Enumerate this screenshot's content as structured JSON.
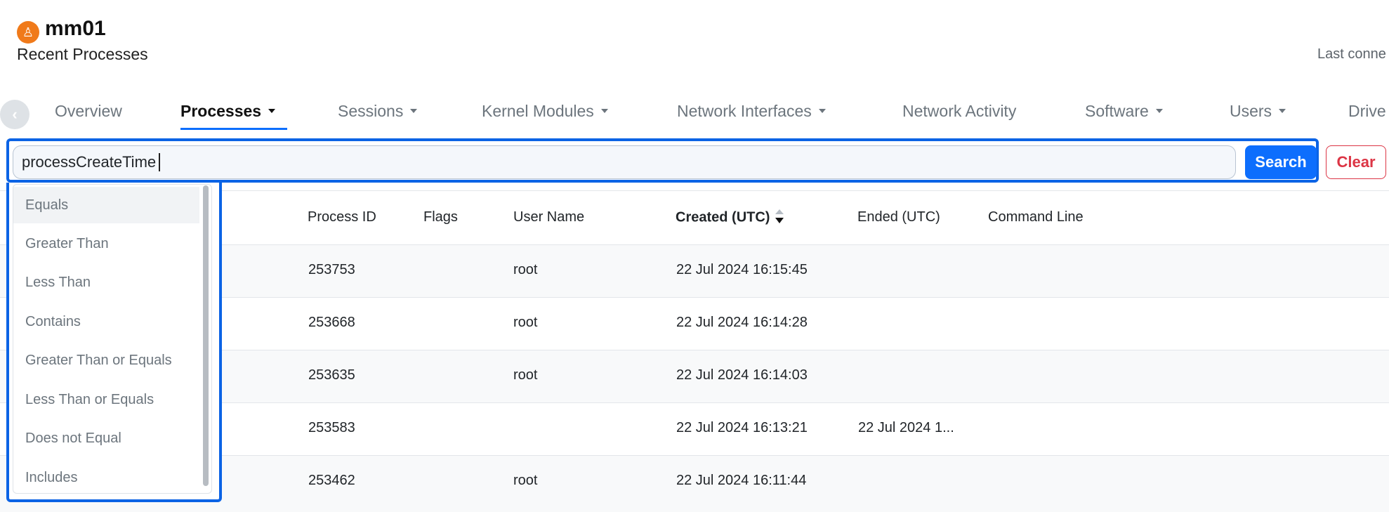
{
  "header": {
    "host_icon": "penguin-icon",
    "host_glyph": "♙",
    "host_name": "mm01",
    "subtitle": "Recent Processes",
    "last_connected": "Last conne"
  },
  "tabs": [
    {
      "label": "Overview",
      "dropdown": false,
      "active": false
    },
    {
      "label": "Processes",
      "dropdown": true,
      "active": true
    },
    {
      "label": "Sessions",
      "dropdown": true,
      "active": false
    },
    {
      "label": "Kernel Modules",
      "dropdown": true,
      "active": false
    },
    {
      "label": "Network Interfaces",
      "dropdown": true,
      "active": false
    },
    {
      "label": "Network Activity",
      "dropdown": false,
      "active": false
    },
    {
      "label": "Software",
      "dropdown": true,
      "active": false
    },
    {
      "label": "Users",
      "dropdown": true,
      "active": false
    },
    {
      "label": "Drive",
      "dropdown": false,
      "active": false
    }
  ],
  "back_glyph": "‹",
  "search": {
    "value": "processCreateTime",
    "search_label": "Search",
    "clear_label": "Clear"
  },
  "operators": [
    "Equals",
    "Greater Than",
    "Less Than",
    "Contains",
    "Greater Than or Equals",
    "Less Than or Equals",
    "Does not Equal",
    "Includes"
  ],
  "table": {
    "columns": {
      "process_id": "Process ID",
      "flags": "Flags",
      "user_name": "User Name",
      "created": "Created (UTC)",
      "ended": "Ended (UTC)",
      "command_line": "Command Line"
    },
    "rows": [
      {
        "pid": "253753",
        "flags": "",
        "user": "root",
        "created": "22 Jul 2024 16:15:45",
        "ended": "",
        "cmd": ""
      },
      {
        "pid": "253668",
        "flags": "",
        "user": "root",
        "created": "22 Jul 2024 16:14:28",
        "ended": "",
        "cmd": ""
      },
      {
        "pid": "253635",
        "flags": "",
        "user": "root",
        "created": "22 Jul 2024 16:14:03",
        "ended": "",
        "cmd": ""
      },
      {
        "pid": "253583",
        "flags": "",
        "user": "",
        "created": "22 Jul 2024 16:13:21",
        "ended": "22 Jul 2024 1...",
        "cmd": ""
      },
      {
        "pid": "253462",
        "flags": "",
        "user": "root",
        "created": "22 Jul 2024 16:11:44",
        "ended": "",
        "cmd": ""
      }
    ]
  },
  "colors": {
    "accent": "#0d6efd",
    "focus_outline": "#0b63e5",
    "danger": "#dc3545",
    "host_badge": "#f07a1a"
  }
}
